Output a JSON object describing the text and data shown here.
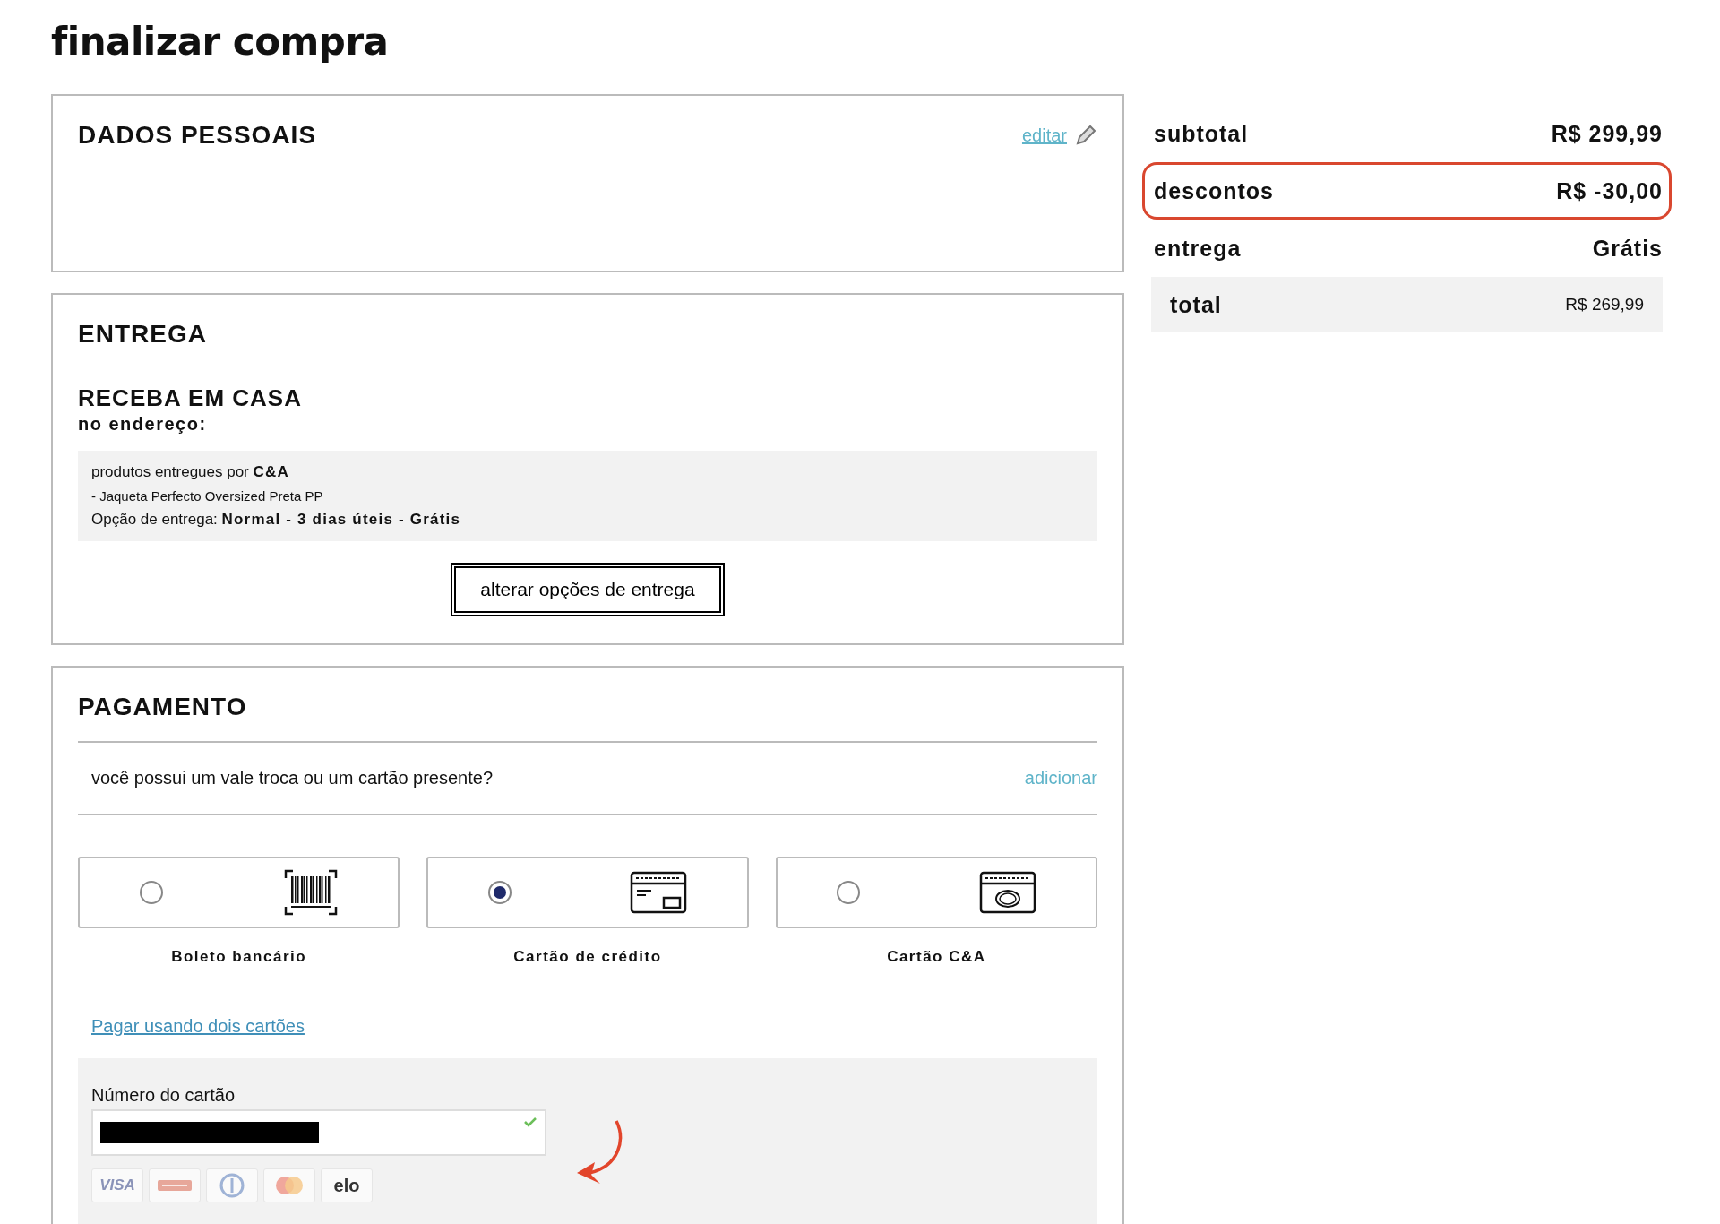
{
  "page_title": "finalizar compra",
  "personal_data": {
    "heading": "DADOS PESSOAIS",
    "edit_link": "editar"
  },
  "delivery": {
    "heading": "ENTREGA",
    "method": "RECEBA EM CASA",
    "address_label": "no endereço:",
    "seller_prefix": "produtos entregues por",
    "seller": "C&A",
    "item": "- Jaqueta Perfecto Oversized Preta PP",
    "option_prefix": "Opção de entrega:",
    "option": "Normal - 3 dias úteis - Grátis",
    "change_button": "alterar opções de entrega"
  },
  "payment": {
    "heading": "PAGAMENTO",
    "gift_question": "você possui um vale troca ou um cartão presente?",
    "gift_link": "adicionar",
    "methods": [
      {
        "kind": "boleto",
        "label": "Boleto bancário",
        "selected": false
      },
      {
        "kind": "credit",
        "label": "Cartão de crédito",
        "selected": true
      },
      {
        "kind": "store",
        "label": "Cartão C&A",
        "selected": false
      }
    ],
    "two_cards_link": "Pagar usando dois cartões",
    "card_number": {
      "label": "Número do cartão",
      "redacted": true,
      "valid": true
    },
    "brands": [
      {
        "kind": "visa",
        "text": "VISA"
      },
      {
        "kind": "hipercard"
      },
      {
        "kind": "diners"
      },
      {
        "kind": "mastercard"
      },
      {
        "kind": "elo",
        "text": "elo"
      }
    ]
  },
  "summary": {
    "rows": [
      {
        "label": "subtotal",
        "value": "R$ 299,99",
        "highlighted": false
      },
      {
        "label": "descontos",
        "value": "R$ -30,00",
        "highlighted": true
      },
      {
        "label": "entrega",
        "value": "Grátis",
        "highlighted": false
      }
    ],
    "total_label": "total",
    "total_value": "R$ 269,99"
  },
  "annotation_arrow": true
}
